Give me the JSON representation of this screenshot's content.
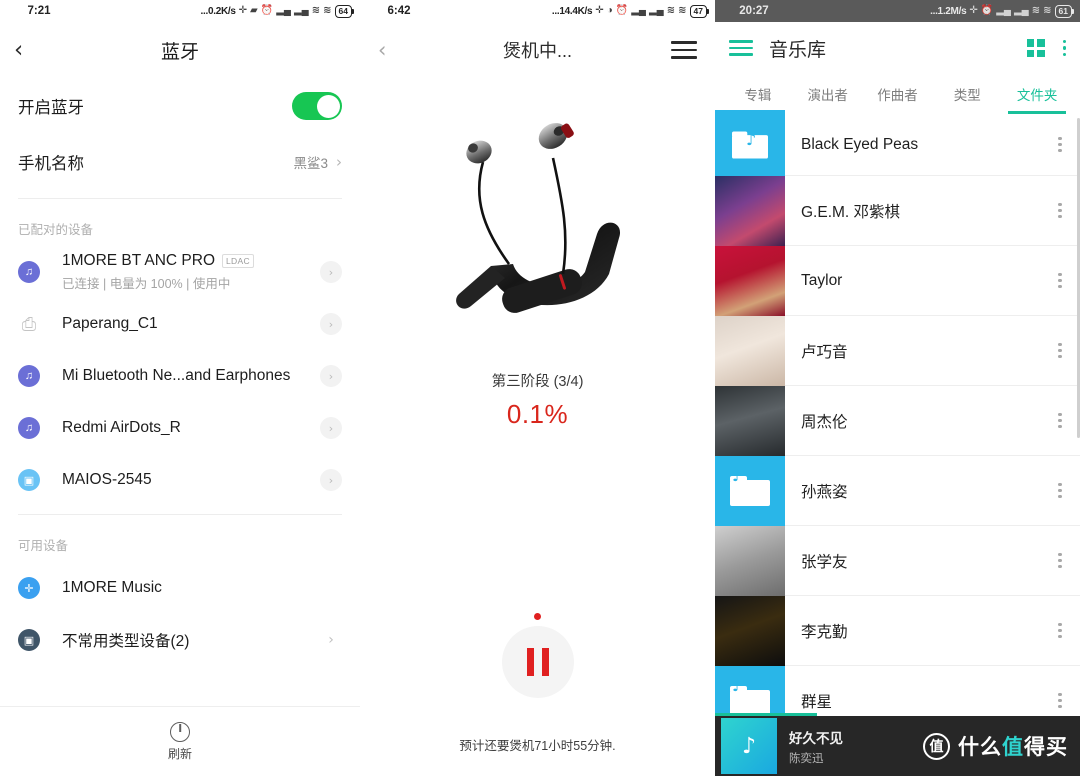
{
  "bluetooth": {
    "statusbar": {
      "time": "7:21",
      "speed": "...0.2K/s",
      "icons": [
        "bluetooth-icon",
        "vibrate-icon",
        "alarm-icon",
        "signal-1-icon",
        "signal-2-icon",
        "wifi-icon",
        "wifi-2-icon"
      ],
      "battery": "64"
    },
    "back_label": "‹",
    "title": "蓝牙",
    "enable_row": {
      "label": "开启蓝牙",
      "toggle_on": true
    },
    "name_row": {
      "label": "手机名称",
      "value": "黑鲨3"
    },
    "paired_section": "已配对的设备",
    "paired_devices": [
      {
        "name": "1MORE BT ANC PRO",
        "badge": "LDAC",
        "sub": "已连接 | 电量为 100% | 使用中",
        "icon": "headphone-icon",
        "icon_color": "purple"
      },
      {
        "name": "Paperang_C1",
        "badge": "",
        "sub": "",
        "icon": "printer-icon",
        "icon_color": "printer"
      },
      {
        "name": "Mi Bluetooth Ne...and Earphones",
        "badge": "",
        "sub": "",
        "icon": "headphone-icon",
        "icon_color": "purple"
      },
      {
        "name": "Redmi AirDots_R",
        "badge": "",
        "sub": "",
        "icon": "headphone-icon",
        "icon_color": "purple"
      },
      {
        "name": "MAIOS-2545",
        "badge": "",
        "sub": "",
        "icon": "device-icon",
        "icon_color": "lblue"
      }
    ],
    "available_section": "可用设备",
    "available_devices": [
      {
        "name": "1MORE Music",
        "icon": "bluetooth-icon",
        "icon_color": "blue",
        "has_arrow": false
      },
      {
        "name": "不常用类型设备(2)",
        "icon": "device-icon",
        "icon_color": "dark",
        "has_arrow": true
      }
    ],
    "refresh_label": "刷新"
  },
  "burnin": {
    "statusbar": {
      "time": "6:42",
      "speed": "...14.4K/s",
      "battery": "47"
    },
    "back_label": "‹",
    "title": "煲机中...",
    "product_alt": "1MORE neckband wireless earphones",
    "stage": "第三阶段 (3/4)",
    "percent": "0.1%",
    "percent_color": "#d9261c",
    "eta": "预计还要煲机71小时55分钟.",
    "pause_label": "pause"
  },
  "music": {
    "statusbar": {
      "time": "20:27",
      "speed": "...1.2M/s",
      "battery": "61"
    },
    "title": "音乐库",
    "accent": "#18c09a",
    "tabs": [
      {
        "label": "专辑",
        "active": false
      },
      {
        "label": "演出者",
        "active": false
      },
      {
        "label": "作曲者",
        "active": false
      },
      {
        "label": "类型",
        "active": false
      },
      {
        "label": "文件夹",
        "active": true
      }
    ],
    "items": [
      {
        "name": "Black Eyed Peas",
        "art": "art-peas",
        "kind": "note"
      },
      {
        "name": "G.E.M. 邓紫棋",
        "art": "art-gem",
        "kind": "photo"
      },
      {
        "name": "Taylor",
        "art": "art-red",
        "kind": "photo"
      },
      {
        "name": "卢巧音",
        "art": "art-lu",
        "kind": "photo"
      },
      {
        "name": "周杰伦",
        "art": "art-jay",
        "kind": "photo"
      },
      {
        "name": "孙燕姿",
        "art": "",
        "kind": "folder"
      },
      {
        "name": "张学友",
        "art": "art-jacky",
        "kind": "photo"
      },
      {
        "name": "李克勤",
        "art": "art-hacken",
        "kind": "photo"
      },
      {
        "name": "群星",
        "art": "",
        "kind": "folder"
      }
    ],
    "nowplaying": {
      "title": "好久不见",
      "artist": "陈奕迅"
    },
    "watermark": {
      "mark": "值",
      "text_a": "什么",
      "text_b": "值",
      "text_c": "得买"
    }
  }
}
